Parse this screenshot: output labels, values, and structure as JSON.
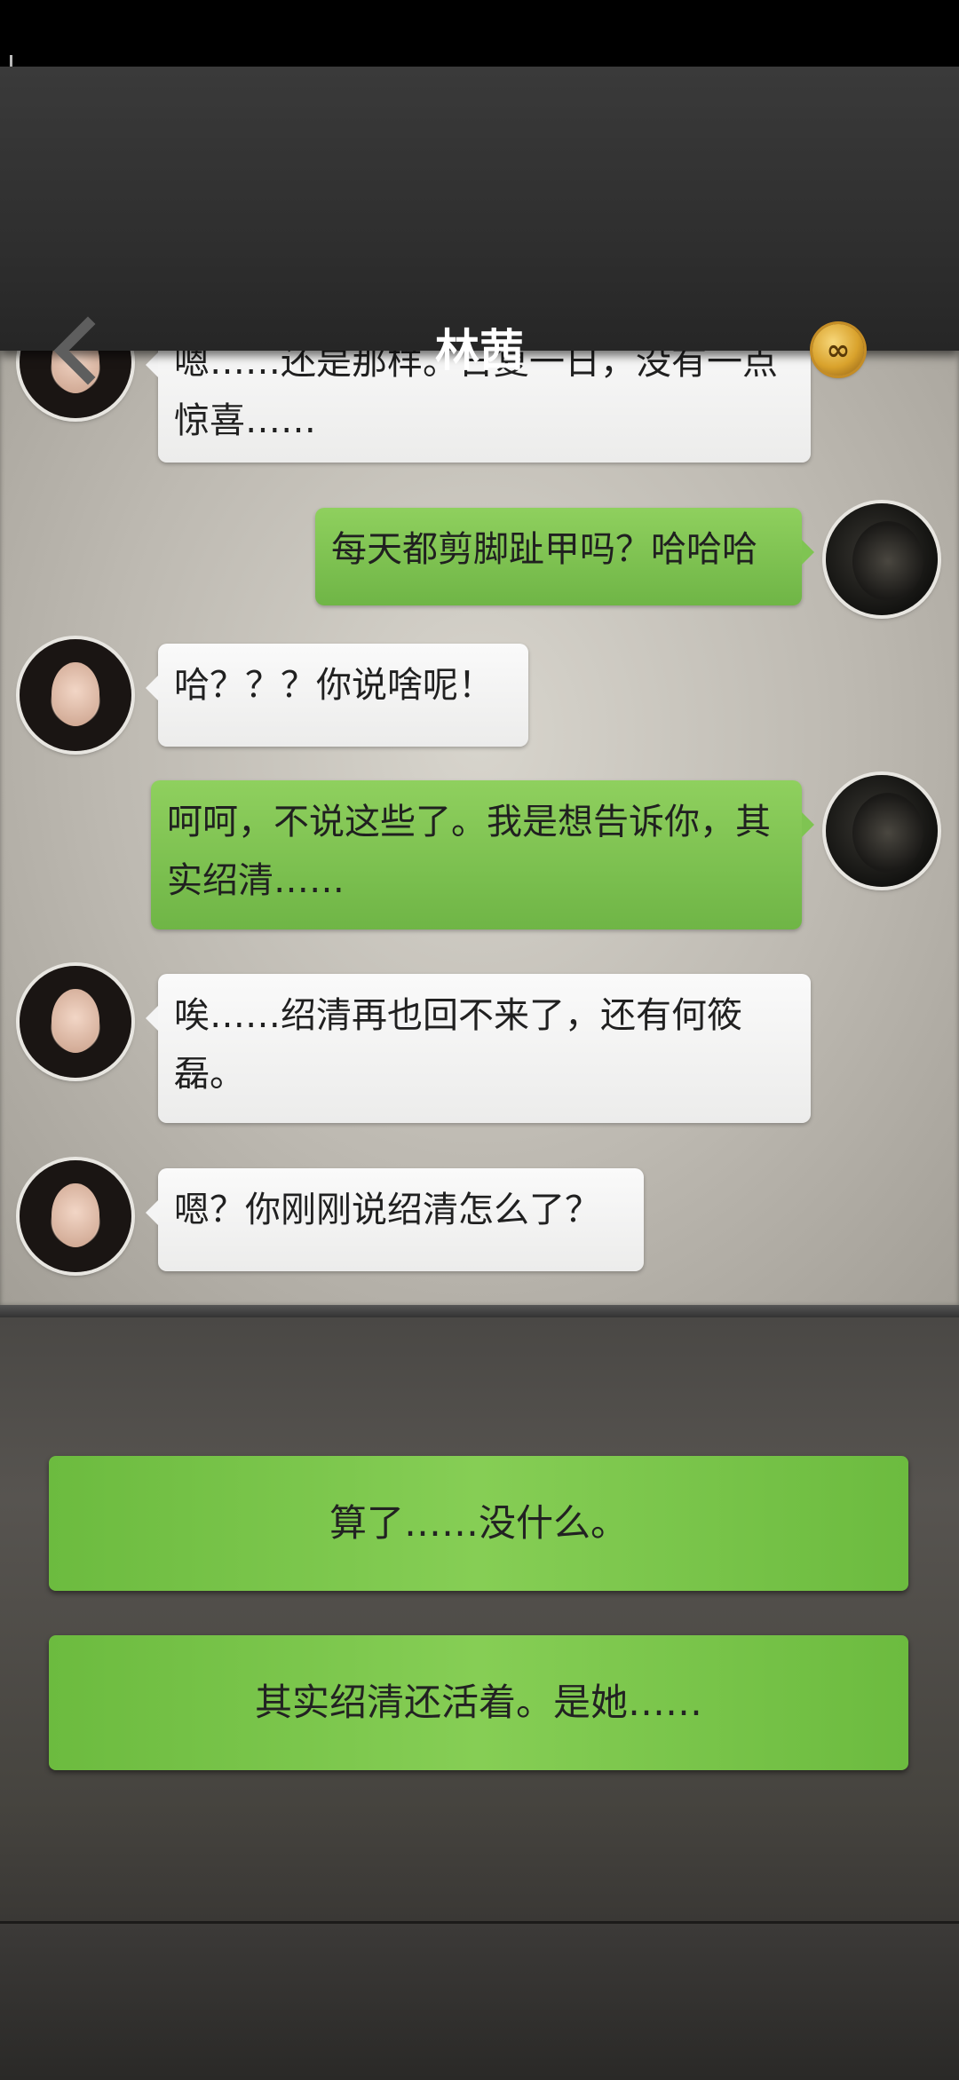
{
  "header": {
    "title": "林茜"
  },
  "icons": {
    "back": "chevron-left-icon",
    "coin": "gold-coin-infinity-icon"
  },
  "messages": [
    {
      "from": "linxi",
      "text": "嗯……还是那样。日复一日，没有一点惊喜……"
    },
    {
      "from": "player",
      "text": "每天都剪脚趾甲吗？哈哈哈"
    },
    {
      "from": "linxi",
      "text": "哈？？？你说啥呢！"
    },
    {
      "from": "player",
      "text": "呵呵，不说这些了。我是想告诉你，其实绍清……"
    },
    {
      "from": "linxi",
      "text": "唉……绍清再也回不来了，还有何筱磊。"
    },
    {
      "from": "linxi",
      "text": "嗯？你刚刚说绍清怎么了？"
    }
  ],
  "choices": [
    {
      "label": "算了……没什么。"
    },
    {
      "label": "其实绍清还活着。是她……"
    }
  ],
  "colors": {
    "bubble_green": "#7fc452",
    "bubble_white": "#f4f4f4",
    "header": "#2f2f2f"
  }
}
